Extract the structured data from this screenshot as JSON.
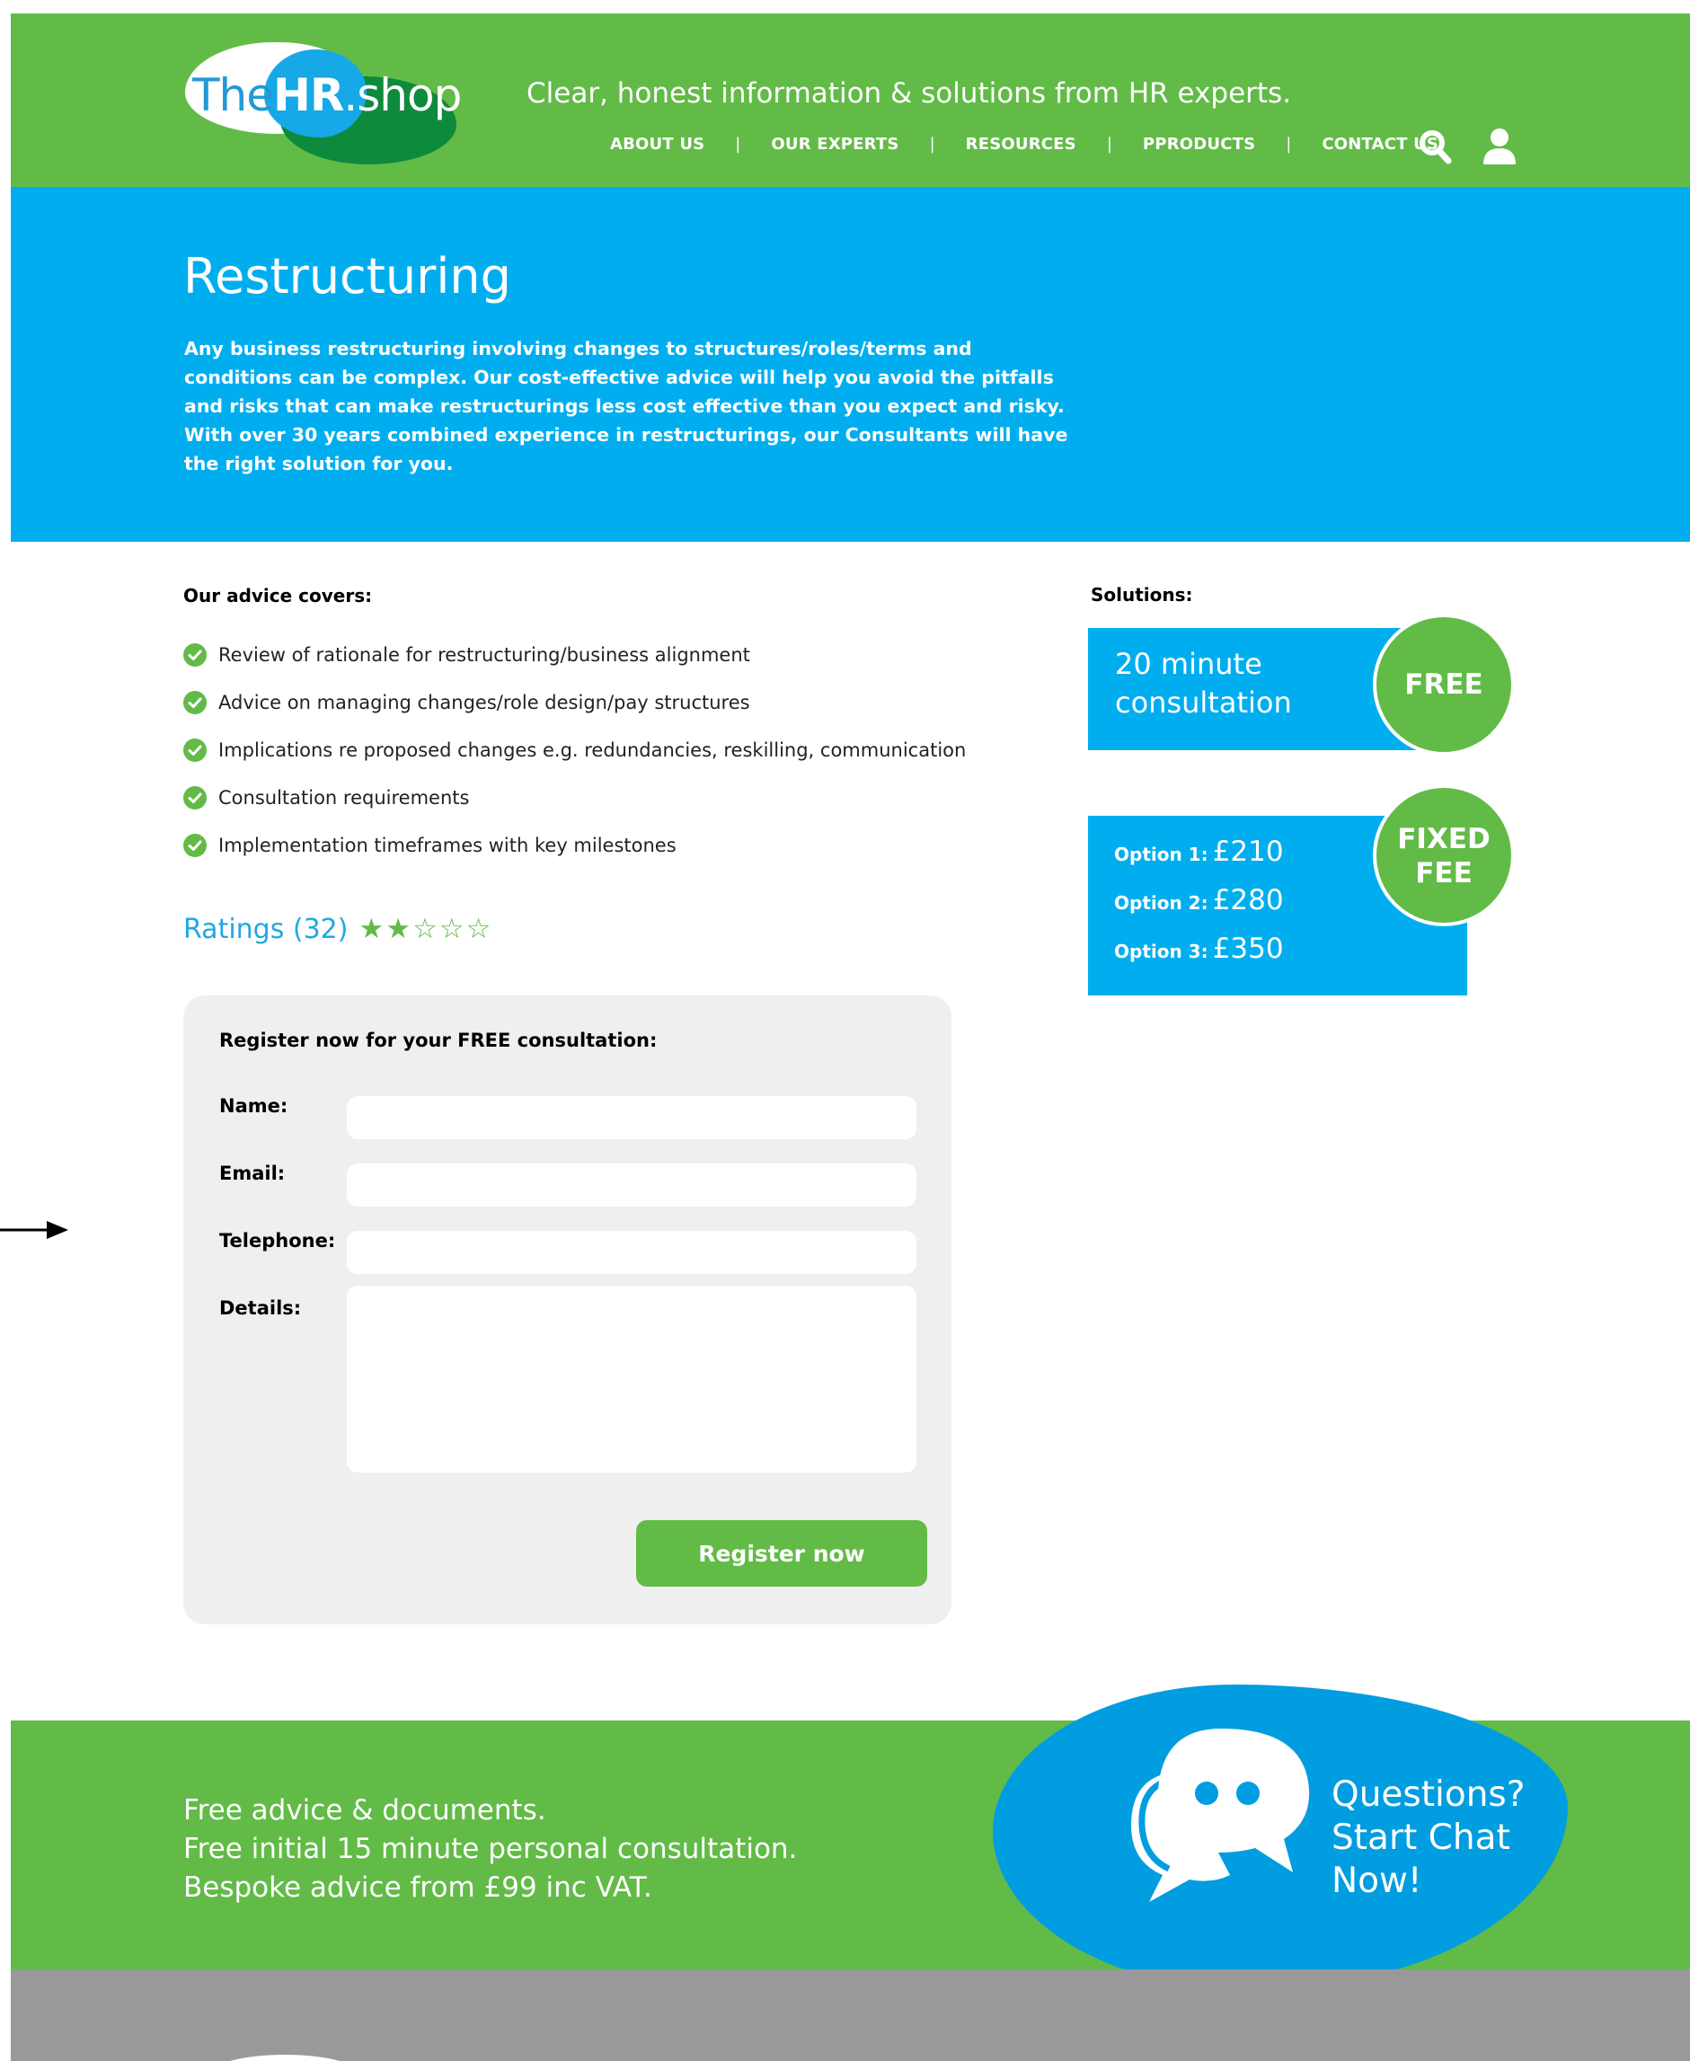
{
  "header": {
    "logo": {
      "the": "The",
      "hr": "HR",
      "shop": ".shop"
    },
    "tagline": "Clear, honest information & solutions from HR experts.",
    "nav": [
      "ABOUT US",
      "OUR EXPERTS",
      "RESOURCES",
      "PPRODUCTS",
      "CONTACT US"
    ],
    "nav_separator": "|",
    "icons": [
      "search-icon",
      "user-icon"
    ]
  },
  "hero": {
    "title": "Restructuring",
    "description": "Any business restructuring involving changes to structures/roles/terms and conditions can be complex. Our cost-effective advice will help you avoid the pitfalls and risks that can make restructurings less cost effective than you expect and risky. With over 30 years combined experience in restructurings, our Consultants will have the right solution for you."
  },
  "advice": {
    "title": "Our advice covers:",
    "items": [
      "Review of rationale for restructuring/business alignment",
      "Advice on managing changes/role design/pay structures",
      "Implications re proposed changes e.g. redundancies, reskilling, communication",
      "Consultation requirements",
      "Implementation timeframes with key milestones"
    ]
  },
  "ratings": {
    "label": "Ratings (32)",
    "score": 2,
    "max": 5,
    "filled_star": "★",
    "empty_star": "☆"
  },
  "form": {
    "title": "Register now for your FREE consultation:",
    "name_label": "Name:",
    "email_label": "Email:",
    "telephone_label": "Telephone:",
    "details_label": "Details:",
    "name_value": "",
    "email_value": "",
    "telephone_value": "",
    "details_value": "",
    "submit_label": "Register now"
  },
  "solutions": {
    "title": "Solutions:",
    "consultation_line1": "20 minute",
    "consultation_line2": "consultation",
    "free_badge": "FREE",
    "fixed_badge_line1": "FIXED",
    "fixed_badge_line2": "FEE",
    "options": [
      {
        "label": "Option 1:",
        "price": "£210"
      },
      {
        "label": "Option 2:",
        "price": "£280"
      },
      {
        "label": "Option 3:",
        "price": "£350"
      }
    ]
  },
  "footer": {
    "lines": [
      "Free advice & documents.",
      "Free initial 15 minute personal consultation.",
      "Bespoke advice from £99 inc VAT."
    ],
    "chat_lines": [
      "Questions?",
      "Start Chat",
      "Now!"
    ]
  },
  "colors": {
    "green": "#62bb47",
    "blue": "#00aeef",
    "dark_green": "#0e8a3c",
    "chat_blue": "#009de0",
    "grey": "#999999"
  }
}
